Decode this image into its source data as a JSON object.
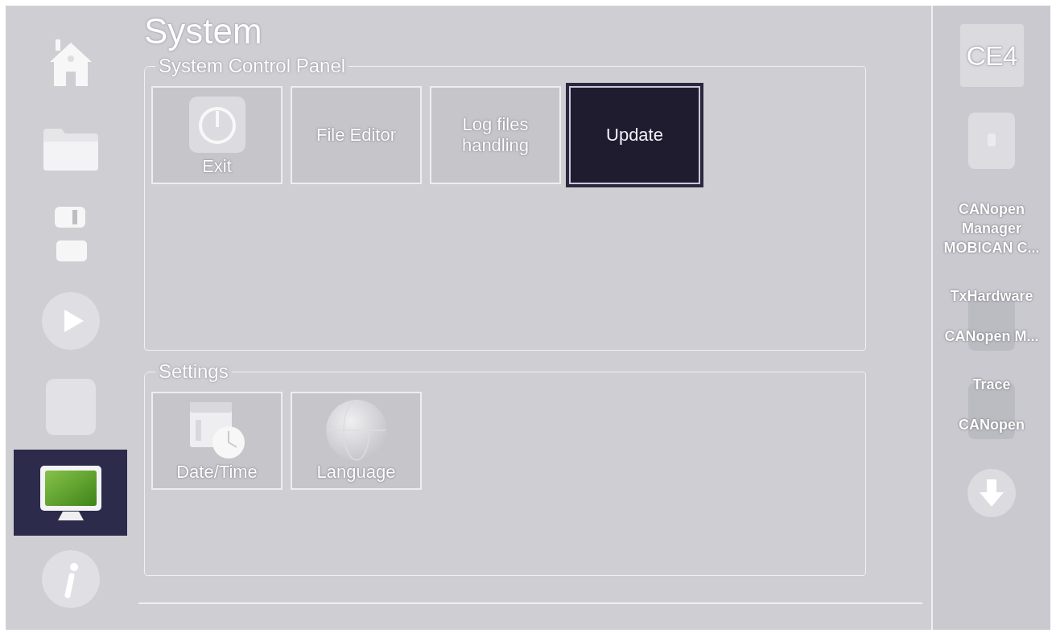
{
  "nav": [
    {
      "selected": false
    },
    {
      "selected": false
    },
    {
      "selected": false
    },
    {
      "selected": false
    },
    {
      "selected": false
    },
    {
      "selected": true
    },
    {
      "selected": false
    }
  ],
  "title": "System",
  "groups": [
    {
      "title": "System Control Panel",
      "tiles": [
        {
          "label": "Exit",
          "kind": "icon",
          "selected": false
        },
        {
          "label": "File Editor",
          "kind": "text",
          "selected": false
        },
        {
          "label": "Log files handling",
          "kind": "text",
          "selected": false
        },
        {
          "label": "Update",
          "kind": "text",
          "selected": true
        }
      ]
    },
    {
      "title": "Settings",
      "tiles": [
        {
          "label": "Date/Time",
          "kind": "icon",
          "selected": false
        },
        {
          "label": "Language",
          "kind": "icon",
          "selected": false
        }
      ]
    }
  ],
  "side_panel": {
    "logo": "CE4",
    "items": [
      {
        "kind": "stacked",
        "title": "CANopen Manager",
        "subtitle": "MOBICAN C..."
      },
      {
        "kind": "overlaid",
        "title": "TxHardware",
        "subtitle": "CANopen M..."
      },
      {
        "kind": "overlaid",
        "title": "Trace",
        "subtitle": "CANopen"
      }
    ]
  }
}
